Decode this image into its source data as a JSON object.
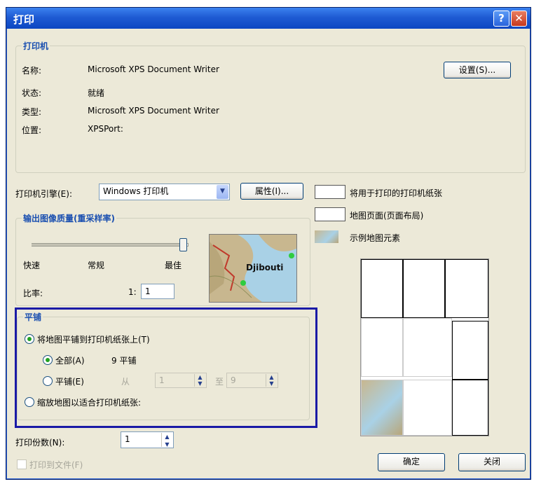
{
  "window": {
    "title": "打印",
    "help_symbol": "?",
    "close_symbol": "✕"
  },
  "printer": {
    "group_label": "打印机",
    "name_label": "名称:",
    "name_value": "Microsoft XPS Document Writer",
    "status_label": "状态:",
    "status_value": "就绪",
    "type_label": "类型:",
    "type_value": "Microsoft XPS Document Writer",
    "location_label": "位置:",
    "location_value": "XPSPort:",
    "setup_button": "设置(S)..."
  },
  "engine": {
    "label": "打印机引擎(E):",
    "selected": "Windows 打印机",
    "properties_button": "属性(I)..."
  },
  "quality": {
    "group_label": "输出图像质量(重采样率)",
    "slider_level": 1.0,
    "labels": [
      "快速",
      "常规",
      "最佳"
    ],
    "ratio_label": "比率:",
    "ratio_prefix": "1:",
    "ratio_value": "1",
    "preview_label": "Djibouti"
  },
  "legend": {
    "paper_label": "将用于打印的打印机纸张",
    "page_label": "地图页面(页面布局)",
    "sample_label": "示例地图元素"
  },
  "tiling": {
    "group_label": "平铺",
    "tile_option": "将地图平铺到打印机纸张上(T)",
    "all_option": "全部(A)",
    "all_count": "9 平铺",
    "pages_option": "平铺(E)",
    "from_label": "从",
    "from_value": "1",
    "to_label": "至",
    "to_value": "9",
    "scale_option": "缩放地图以适合打印机纸张:"
  },
  "copies": {
    "label": "打印份数(N):",
    "value": "1"
  },
  "print_to_file": "打印到文件(F)",
  "buttons": {
    "ok": "确定",
    "close": "关闭"
  },
  "colors": {
    "title_bar": "#1f5bd3",
    "highlight_border": "#1a1aa6",
    "dialog_bg": "#ece9d8"
  }
}
